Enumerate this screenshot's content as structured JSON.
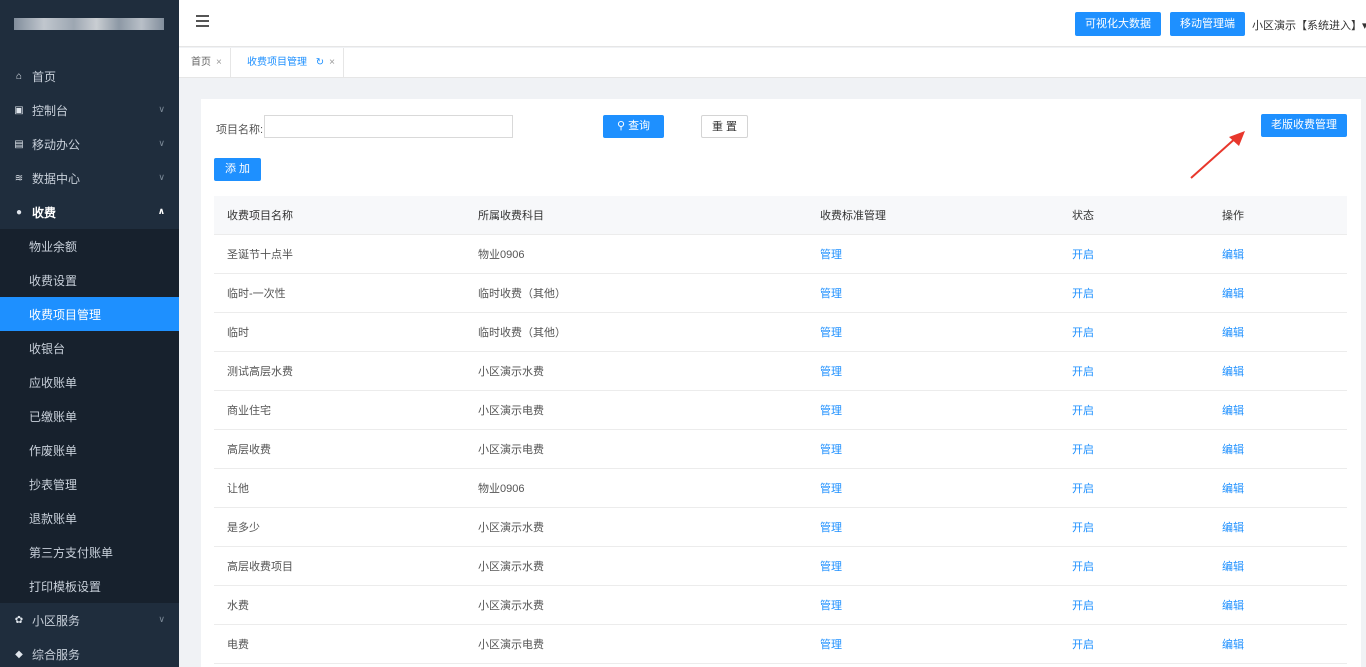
{
  "sidebar": {
    "items": [
      {
        "label": "首页",
        "icon": "home-icon"
      },
      {
        "label": "控制台",
        "icon": "monitor-icon"
      },
      {
        "label": "移动办公",
        "icon": "briefcase-icon"
      },
      {
        "label": "数据中心",
        "icon": "database-icon"
      },
      {
        "label": "收费",
        "icon": "coin-icon"
      }
    ],
    "charge_submenu": [
      "物业余额",
      "收费设置",
      "收费项目管理",
      "收银台",
      "应收账单",
      "已缴账单",
      "作废账单",
      "抄表管理",
      "退款账单",
      "第三方支付账单",
      "打印模板设置"
    ],
    "after_items": [
      {
        "label": "小区服务",
        "icon": "gift-icon"
      },
      {
        "label": "综合服务",
        "icon": "service-icon"
      }
    ]
  },
  "topbar": {
    "btn_bigdata": "可视化大数据",
    "btn_mobile": "移动管理端",
    "user": "小区演示【系统进入】▾"
  },
  "tabs": [
    {
      "label": "首页"
    },
    {
      "label": "收费项目管理"
    }
  ],
  "search": {
    "label": "项目名称:",
    "value": "",
    "placeholder": "",
    "query_label": "查询",
    "reset_label": "重 置",
    "old_version_label": "老版收费管理",
    "add_label": "添 加"
  },
  "table": {
    "headers": [
      "收费项目名称",
      "所属收费科目",
      "收费标准管理",
      "状态",
      "操作"
    ],
    "rows": [
      [
        "圣诞节十点半",
        "物业0906",
        "管理",
        "开启",
        "编辑"
      ],
      [
        "临时-一次性",
        "临时收费（其他）",
        "管理",
        "开启",
        "编辑"
      ],
      [
        "临时",
        "临时收费（其他）",
        "管理",
        "开启",
        "编辑"
      ],
      [
        "测试高层水费",
        "小区演示水费",
        "管理",
        "开启",
        "编辑"
      ],
      [
        "商业住宅",
        "小区演示电费",
        "管理",
        "开启",
        "编辑"
      ],
      [
        "高层收费",
        "小区演示电费",
        "管理",
        "开启",
        "编辑"
      ],
      [
        "让他",
        "物业0906",
        "管理",
        "开启",
        "编辑"
      ],
      [
        "是多少",
        "小区演示水费",
        "管理",
        "开启",
        "编辑"
      ],
      [
        "高层收费项目",
        "小区演示水费",
        "管理",
        "开启",
        "编辑"
      ],
      [
        "水费",
        "小区演示水费",
        "管理",
        "开启",
        "编辑"
      ],
      [
        "电费",
        "小区演示电费",
        "管理",
        "开启",
        "编辑"
      ]
    ]
  },
  "colors": {
    "sidebar_bg": "#1f2d3d",
    "accent": "#1e90ff",
    "arrow": "#e8372c"
  }
}
